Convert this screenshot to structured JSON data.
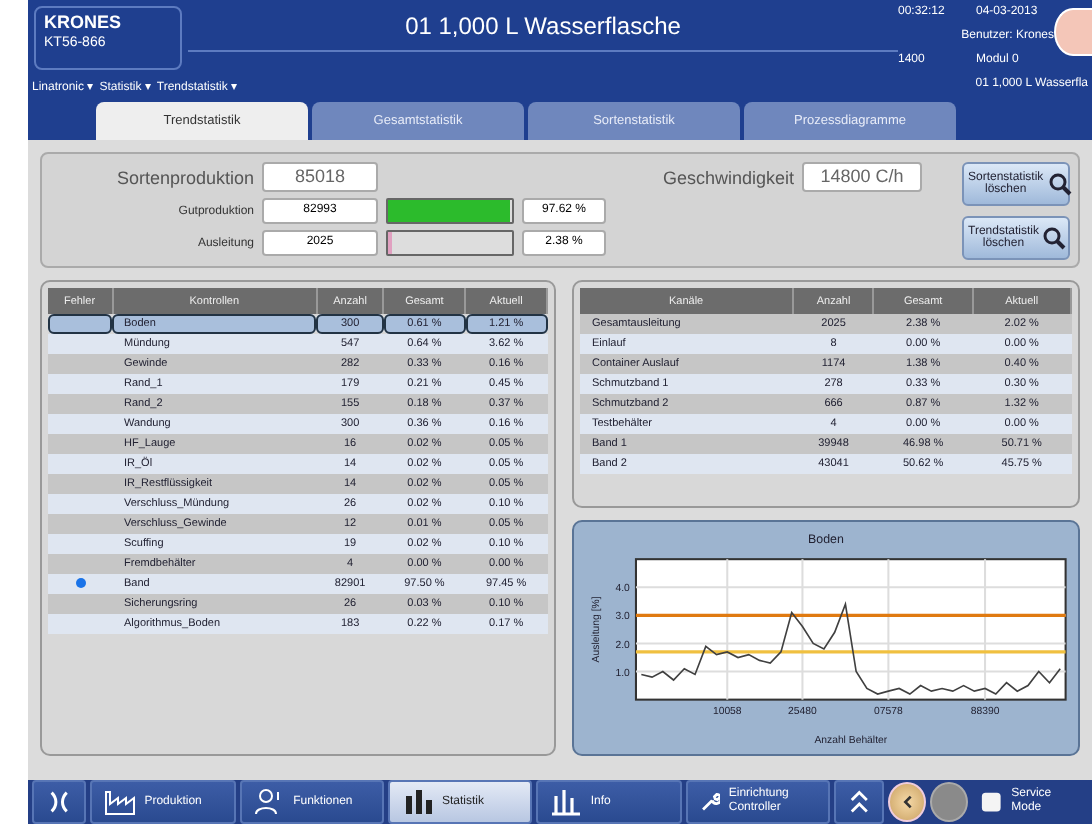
{
  "header": {
    "logo": "KRONES",
    "machine": "KT56-866",
    "title": "01 1,000 L Wasserflasche",
    "time": "00:32:12",
    "date": "04-03-2013",
    "user": "Benutzer: Krones",
    "line": "1400",
    "mode": "Modul 0",
    "product": "01 1,000 L Wasserfla"
  },
  "breadcrumb": [
    "Linatronic ▾",
    "Statistik ▾",
    "Trendstatistik ▾"
  ],
  "tabs": [
    {
      "label": "Trendstatistik",
      "selected": true
    },
    {
      "label": "Gesamtstatistik",
      "selected": false
    },
    {
      "label": "Sortenstatistik",
      "selected": false
    },
    {
      "label": "Prozessdiagramme",
      "selected": false
    }
  ],
  "summary": {
    "production_label": "Sortenproduktion",
    "production_value": "85018",
    "rows": [
      {
        "label": "Gutproduktion",
        "value": "82993",
        "level": 0.98,
        "color": "#2cbb2c",
        "percent": "97.62 %"
      },
      {
        "label": "Ausleitung",
        "value": "2025",
        "level": 0.03,
        "color": "#e0a0c0",
        "percent": "2.38 %"
      }
    ],
    "speed_label": "Geschwindigkeit",
    "speed_value": "14800 C/h",
    "buttons": [
      "Sortenstatistik löschen",
      "Trendstatistik löschen"
    ]
  },
  "controls_table": {
    "fault_column": "Fehler",
    "columns": [
      "Kontrollen",
      "Anzahl",
      "Gesamt",
      "Aktuell"
    ],
    "rows": [
      {
        "fault": false,
        "selected": true,
        "cells": [
          "Boden",
          "300",
          "0.61 %",
          "1.21 %"
        ]
      },
      {
        "fault": false,
        "selected": false,
        "cells": [
          "Mündung",
          "547",
          "0.64 %",
          "3.62 %"
        ]
      },
      {
        "fault": false,
        "selected": false,
        "cells": [
          "Gewinde",
          "282",
          "0.33 %",
          "0.16 %"
        ]
      },
      {
        "fault": false,
        "selected": false,
        "cells": [
          "Rand_1",
          "179",
          "0.21 %",
          "0.45 %"
        ]
      },
      {
        "fault": false,
        "selected": false,
        "cells": [
          "Rand_2",
          "155",
          "0.18 %",
          "0.37 %"
        ]
      },
      {
        "fault": false,
        "selected": false,
        "cells": [
          "Wandung",
          "300",
          "0.36 %",
          "0.16 %"
        ]
      },
      {
        "fault": false,
        "selected": false,
        "cells": [
          "HF_Lauge",
          "16",
          "0.02 %",
          "0.05 %"
        ]
      },
      {
        "fault": false,
        "selected": false,
        "cells": [
          "IR_Öl",
          "14",
          "0.02 %",
          "0.05 %"
        ]
      },
      {
        "fault": false,
        "selected": false,
        "cells": [
          "IR_Restflüssigkeit",
          "14",
          "0.02 %",
          "0.05 %"
        ]
      },
      {
        "fault": false,
        "selected": false,
        "cells": [
          "Verschluss_Mündung",
          "26",
          "0.02 %",
          "0.10 %"
        ]
      },
      {
        "fault": false,
        "selected": false,
        "cells": [
          "Verschluss_Gewinde",
          "12",
          "0.01 %",
          "0.05 %"
        ]
      },
      {
        "fault": false,
        "selected": false,
        "cells": [
          "Scuffing",
          "19",
          "0.02 %",
          "0.10 %"
        ]
      },
      {
        "fault": false,
        "selected": false,
        "cells": [
          "Fremdbehälter",
          "4",
          "0.00 %",
          "0.00 %"
        ]
      },
      {
        "fault": true,
        "selected": false,
        "cells": [
          "Band",
          "82901",
          "97.50 %",
          "97.45 %"
        ]
      },
      {
        "fault": false,
        "selected": false,
        "cells": [
          "Sicherungsring",
          "26",
          "0.03 %",
          "0.10 %"
        ]
      },
      {
        "fault": false,
        "selected": false,
        "cells": [
          "Algorithmus_Boden",
          "183",
          "0.22 %",
          "0.17 %"
        ]
      }
    ]
  },
  "channels_table": {
    "columns": [
      "Kanäle",
      "Anzahl",
      "Gesamt",
      "Aktuell"
    ],
    "rows": [
      [
        "Gesamtausleitung",
        "2025",
        "2.38 %",
        "2.02 %"
      ],
      [
        "Einlauf",
        "8",
        "0.00 %",
        "0.00 %"
      ],
      [
        "Container Auslauf",
        "1174",
        "1.38 %",
        "0.40 %"
      ],
      [
        "Schmutzband 1",
        "278",
        "0.33 %",
        "0.30 %"
      ],
      [
        "Schmutzband 2",
        "666",
        "0.87 %",
        "1.32 %"
      ],
      [
        "Testbehälter",
        "4",
        "0.00 %",
        "0.00 %"
      ],
      [
        "Band 1",
        "39948",
        "46.98 %",
        "50.71 %"
      ],
      [
        "Band 2",
        "43041",
        "50.62 %",
        "45.75 %"
      ]
    ]
  },
  "chart_panel": {
    "chart_data": {
      "type": "line",
      "title": "Boden",
      "xlabel": "Anzahl Behälter",
      "ylabel": "Ausleitung [%]",
      "categories": [
        null,
        null,
        null,
        null,
        null,
        null,
        null,
        null,
        "10058",
        null,
        null,
        null,
        null,
        null,
        null,
        "25480",
        null,
        null,
        null,
        null,
        null,
        null,
        null,
        "07578",
        null,
        null,
        null,
        null,
        null,
        null,
        null,
        null,
        "88390",
        null,
        null,
        null,
        null,
        null,
        null,
        null
      ],
      "series": [
        {
          "color": "#404040",
          "values": [
            0.9,
            0.8,
            1.0,
            0.7,
            1.1,
            0.9,
            1.9,
            1.6,
            1.7,
            1.5,
            1.6,
            1.4,
            1.3,
            1.7,
            3.1,
            2.6,
            2.0,
            1.8,
            2.4,
            3.4,
            1.0,
            0.4,
            0.2,
            0.3,
            0.4,
            0.2,
            0.5,
            0.3,
            0.4,
            0.3,
            0.5,
            0.3,
            0.4,
            0.2,
            0.6,
            0.3,
            0.5,
            1.0,
            0.6,
            1.1
          ]
        }
      ],
      "ylim": [
        0,
        5
      ],
      "grid": true,
      "yticks": [
        {
          "value": 1,
          "label": "1.0"
        },
        {
          "value": 2,
          "label": "2.0"
        },
        {
          "value": 3,
          "label": "3.0"
        },
        {
          "value": 4,
          "label": "4.0"
        }
      ],
      "ref_lines": [
        {
          "axis": "y",
          "value": 3.0,
          "color": "#e07a10"
        },
        {
          "axis": "y",
          "value": 1.7,
          "color": "#f0c040"
        }
      ]
    }
  },
  "taskbar": [
    {
      "kind": "logo"
    },
    {
      "kind": "factory",
      "label": "Produktion",
      "selected": false
    },
    {
      "kind": "person",
      "label": "Funktionen",
      "selected": false
    },
    {
      "kind": "chart",
      "label": "Statistik",
      "selected": true
    },
    {
      "kind": "bars",
      "label": "Info",
      "selected": false
    },
    {
      "kind": "wrench",
      "label": "Einrichtung Controller",
      "selected": false
    },
    {
      "kind": "chevron"
    },
    {
      "kind": "back",
      "disabled": false
    },
    {
      "kind": "forward",
      "disabled": true
    },
    {
      "kind": "service",
      "label": "Service Mode"
    }
  ]
}
